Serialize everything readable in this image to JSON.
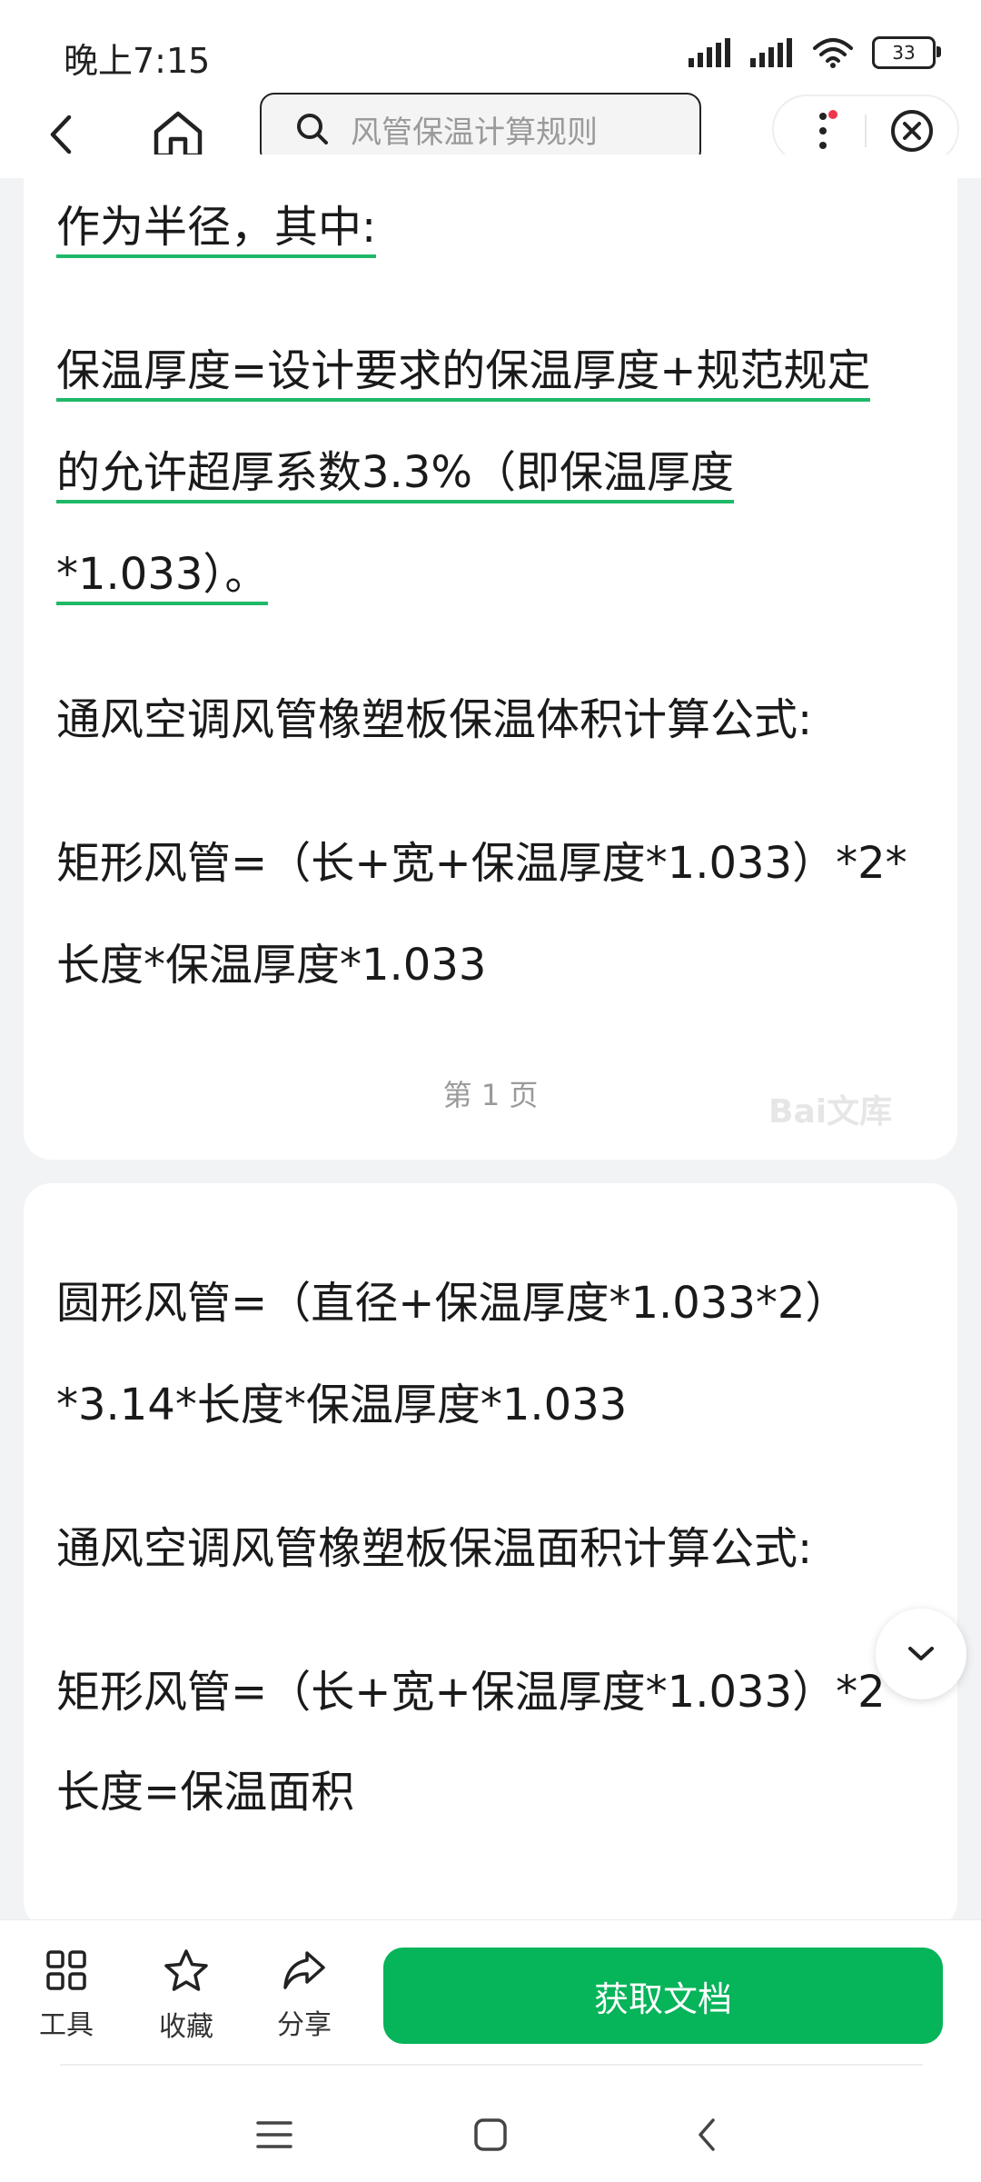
{
  "status_bar": {
    "time": "晚上7:15",
    "battery": "33"
  },
  "nav": {
    "search_placeholder": "风管保温计算规则"
  },
  "document": {
    "page1_lines": [
      "作为半径，其中:",
      "保温厚度=设计要求的保温厚度+规范规定",
      "的允许超厚系数3.3%（即保温厚度",
      "*1.033）。",
      "通风空调风管橡塑板保温体积计算公式:",
      "矩形风管=（长+宽+保温厚度*1.033）*2*",
      "长度*保温厚度*1.033"
    ],
    "page_number": "第 1 页",
    "watermark": "Bai文库",
    "page2_lines": [
      "圆形风管=（直径+保温厚度*1.033*2）",
      "*3.14*长度*保温厚度*1.033",
      "通风空调风管橡塑板保温面积计算公式:",
      "矩形风管=（长+宽+保温厚度*1.033）*2",
      "长度=保温面积"
    ]
  },
  "bottom_bar": {
    "tools_label": "工具",
    "favorite_label": "收藏",
    "share_label": "分享",
    "get_document_label": "获取文档"
  },
  "colors": {
    "accent_green": "#06b45a",
    "underline_green": "#1fb868",
    "notification_red": "#f0364a"
  }
}
